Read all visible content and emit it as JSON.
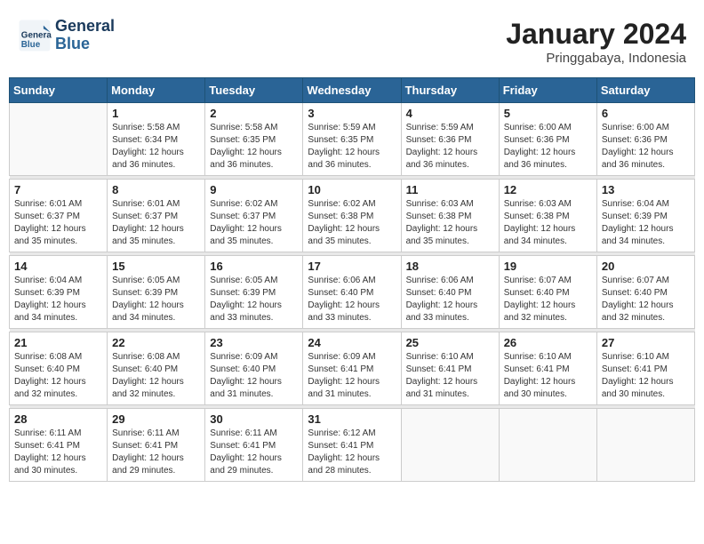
{
  "header": {
    "logo_line1": "General",
    "logo_line2": "Blue",
    "month_year": "January 2024",
    "location": "Pringgabaya, Indonesia"
  },
  "weekdays": [
    "Sunday",
    "Monday",
    "Tuesday",
    "Wednesday",
    "Thursday",
    "Friday",
    "Saturday"
  ],
  "weeks": [
    [
      {
        "day": "",
        "sunrise": "",
        "sunset": "",
        "daylight": "",
        "empty": true
      },
      {
        "day": "1",
        "sunrise": "Sunrise: 5:58 AM",
        "sunset": "Sunset: 6:34 PM",
        "daylight": "Daylight: 12 hours and 36 minutes."
      },
      {
        "day": "2",
        "sunrise": "Sunrise: 5:58 AM",
        "sunset": "Sunset: 6:35 PM",
        "daylight": "Daylight: 12 hours and 36 minutes."
      },
      {
        "day": "3",
        "sunrise": "Sunrise: 5:59 AM",
        "sunset": "Sunset: 6:35 PM",
        "daylight": "Daylight: 12 hours and 36 minutes."
      },
      {
        "day": "4",
        "sunrise": "Sunrise: 5:59 AM",
        "sunset": "Sunset: 6:36 PM",
        "daylight": "Daylight: 12 hours and 36 minutes."
      },
      {
        "day": "5",
        "sunrise": "Sunrise: 6:00 AM",
        "sunset": "Sunset: 6:36 PM",
        "daylight": "Daylight: 12 hours and 36 minutes."
      },
      {
        "day": "6",
        "sunrise": "Sunrise: 6:00 AM",
        "sunset": "Sunset: 6:36 PM",
        "daylight": "Daylight: 12 hours and 36 minutes."
      }
    ],
    [
      {
        "day": "7",
        "sunrise": "Sunrise: 6:01 AM",
        "sunset": "Sunset: 6:37 PM",
        "daylight": "Daylight: 12 hours and 35 minutes."
      },
      {
        "day": "8",
        "sunrise": "Sunrise: 6:01 AM",
        "sunset": "Sunset: 6:37 PM",
        "daylight": "Daylight: 12 hours and 35 minutes."
      },
      {
        "day": "9",
        "sunrise": "Sunrise: 6:02 AM",
        "sunset": "Sunset: 6:37 PM",
        "daylight": "Daylight: 12 hours and 35 minutes."
      },
      {
        "day": "10",
        "sunrise": "Sunrise: 6:02 AM",
        "sunset": "Sunset: 6:38 PM",
        "daylight": "Daylight: 12 hours and 35 minutes."
      },
      {
        "day": "11",
        "sunrise": "Sunrise: 6:03 AM",
        "sunset": "Sunset: 6:38 PM",
        "daylight": "Daylight: 12 hours and 35 minutes."
      },
      {
        "day": "12",
        "sunrise": "Sunrise: 6:03 AM",
        "sunset": "Sunset: 6:38 PM",
        "daylight": "Daylight: 12 hours and 34 minutes."
      },
      {
        "day": "13",
        "sunrise": "Sunrise: 6:04 AM",
        "sunset": "Sunset: 6:39 PM",
        "daylight": "Daylight: 12 hours and 34 minutes."
      }
    ],
    [
      {
        "day": "14",
        "sunrise": "Sunrise: 6:04 AM",
        "sunset": "Sunset: 6:39 PM",
        "daylight": "Daylight: 12 hours and 34 minutes."
      },
      {
        "day": "15",
        "sunrise": "Sunrise: 6:05 AM",
        "sunset": "Sunset: 6:39 PM",
        "daylight": "Daylight: 12 hours and 34 minutes."
      },
      {
        "day": "16",
        "sunrise": "Sunrise: 6:05 AM",
        "sunset": "Sunset: 6:39 PM",
        "daylight": "Daylight: 12 hours and 33 minutes."
      },
      {
        "day": "17",
        "sunrise": "Sunrise: 6:06 AM",
        "sunset": "Sunset: 6:40 PM",
        "daylight": "Daylight: 12 hours and 33 minutes."
      },
      {
        "day": "18",
        "sunrise": "Sunrise: 6:06 AM",
        "sunset": "Sunset: 6:40 PM",
        "daylight": "Daylight: 12 hours and 33 minutes."
      },
      {
        "day": "19",
        "sunrise": "Sunrise: 6:07 AM",
        "sunset": "Sunset: 6:40 PM",
        "daylight": "Daylight: 12 hours and 32 minutes."
      },
      {
        "day": "20",
        "sunrise": "Sunrise: 6:07 AM",
        "sunset": "Sunset: 6:40 PM",
        "daylight": "Daylight: 12 hours and 32 minutes."
      }
    ],
    [
      {
        "day": "21",
        "sunrise": "Sunrise: 6:08 AM",
        "sunset": "Sunset: 6:40 PM",
        "daylight": "Daylight: 12 hours and 32 minutes."
      },
      {
        "day": "22",
        "sunrise": "Sunrise: 6:08 AM",
        "sunset": "Sunset: 6:40 PM",
        "daylight": "Daylight: 12 hours and 32 minutes."
      },
      {
        "day": "23",
        "sunrise": "Sunrise: 6:09 AM",
        "sunset": "Sunset: 6:40 PM",
        "daylight": "Daylight: 12 hours and 31 minutes."
      },
      {
        "day": "24",
        "sunrise": "Sunrise: 6:09 AM",
        "sunset": "Sunset: 6:41 PM",
        "daylight": "Daylight: 12 hours and 31 minutes."
      },
      {
        "day": "25",
        "sunrise": "Sunrise: 6:10 AM",
        "sunset": "Sunset: 6:41 PM",
        "daylight": "Daylight: 12 hours and 31 minutes."
      },
      {
        "day": "26",
        "sunrise": "Sunrise: 6:10 AM",
        "sunset": "Sunset: 6:41 PM",
        "daylight": "Daylight: 12 hours and 30 minutes."
      },
      {
        "day": "27",
        "sunrise": "Sunrise: 6:10 AM",
        "sunset": "Sunset: 6:41 PM",
        "daylight": "Daylight: 12 hours and 30 minutes."
      }
    ],
    [
      {
        "day": "28",
        "sunrise": "Sunrise: 6:11 AM",
        "sunset": "Sunset: 6:41 PM",
        "daylight": "Daylight: 12 hours and 30 minutes."
      },
      {
        "day": "29",
        "sunrise": "Sunrise: 6:11 AM",
        "sunset": "Sunset: 6:41 PM",
        "daylight": "Daylight: 12 hours and 29 minutes."
      },
      {
        "day": "30",
        "sunrise": "Sunrise: 6:11 AM",
        "sunset": "Sunset: 6:41 PM",
        "daylight": "Daylight: 12 hours and 29 minutes."
      },
      {
        "day": "31",
        "sunrise": "Sunrise: 6:12 AM",
        "sunset": "Sunset: 6:41 PM",
        "daylight": "Daylight: 12 hours and 28 minutes."
      },
      {
        "day": "",
        "sunrise": "",
        "sunset": "",
        "daylight": "",
        "empty": true
      },
      {
        "day": "",
        "sunrise": "",
        "sunset": "",
        "daylight": "",
        "empty": true
      },
      {
        "day": "",
        "sunrise": "",
        "sunset": "",
        "daylight": "",
        "empty": true
      }
    ]
  ]
}
